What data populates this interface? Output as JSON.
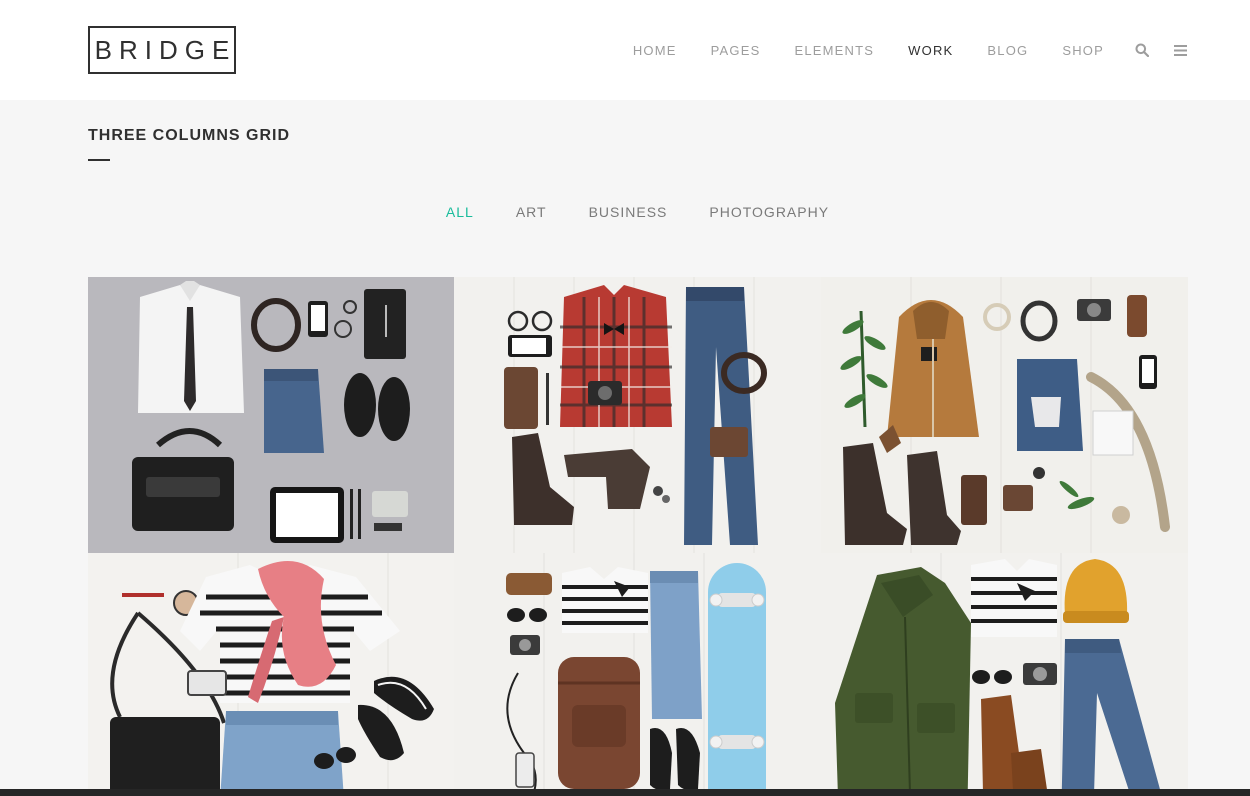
{
  "header": {
    "logo_text": "BRIDGE",
    "nav": [
      "HOME",
      "PAGES",
      "ELEMENTS",
      "WORK",
      "BLOG",
      "SHOP"
    ],
    "active_nav": "WORK",
    "icons": [
      "search-icon",
      "menu-icon"
    ]
  },
  "page": {
    "title": "THREE COLUMNS GRID"
  },
  "filters": {
    "items": [
      "ALL",
      "ART",
      "BUSINESS",
      "PHOTOGRAPHY"
    ],
    "active": "ALL"
  },
  "colors": {
    "accent": "#1abc9c",
    "text_dark": "#303030",
    "nav_gray": "#9d9d9d",
    "background": "#f6f6f6",
    "footer_bar": "#262626"
  },
  "portfolio": {
    "items": [
      "flat-lay-business-outfit",
      "flat-lay-plaid-shirt-jeans",
      "flat-lay-hoodie-outdoor",
      "flat-lay-striped-top-scarf",
      "flat-lay-skateboard-outfit",
      "flat-lay-green-jacket-beanie"
    ]
  }
}
